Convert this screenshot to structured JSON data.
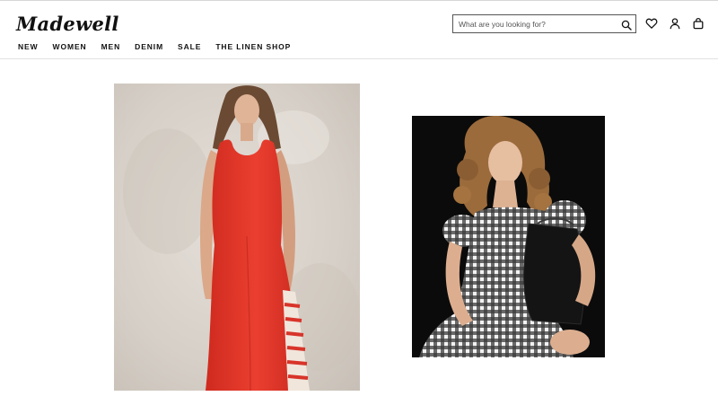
{
  "brand": {
    "logo_text": "Madewell"
  },
  "nav": {
    "items": [
      {
        "label": "NEW"
      },
      {
        "label": "WOMEN"
      },
      {
        "label": "MEN"
      },
      {
        "label": "DENIM"
      },
      {
        "label": "SALE"
      },
      {
        "label": "THE LINEN SHOP"
      }
    ]
  },
  "search": {
    "placeholder": "What are you looking for?",
    "value": "",
    "icon": "search-icon"
  },
  "header_icons": [
    "heart-icon",
    "user-icon",
    "bag-icon"
  ],
  "images": [
    {
      "name": "model-red-tank-dress",
      "colors": {
        "dress": "#e8392c",
        "background": "#d9d3cc"
      }
    },
    {
      "name": "model-gingham-dress",
      "colors": {
        "background": "#0b0b0b"
      }
    }
  ]
}
